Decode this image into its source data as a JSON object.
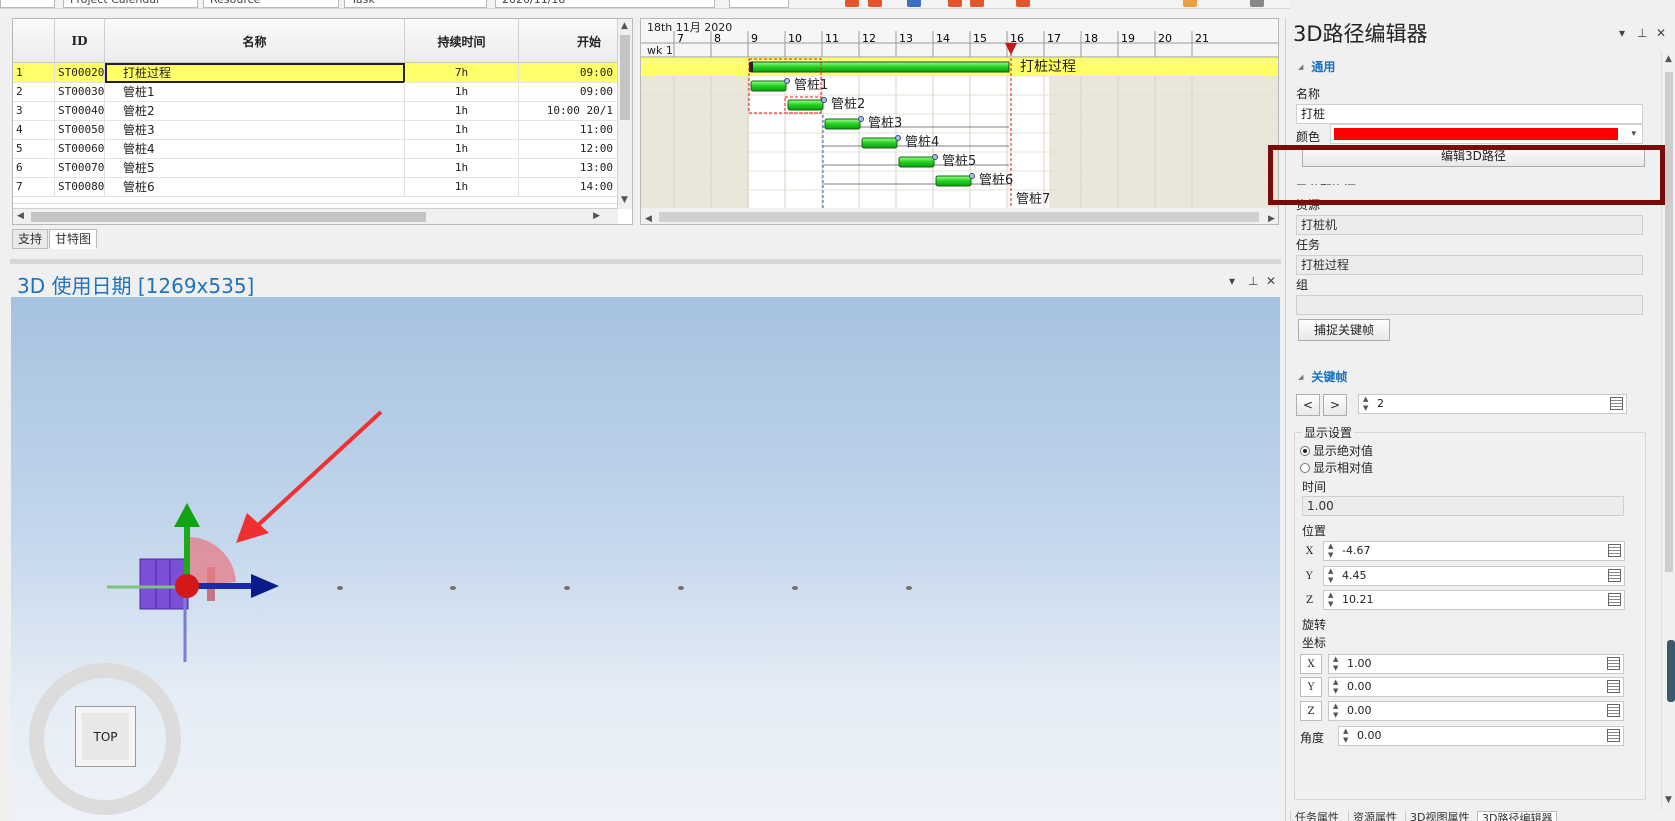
{
  "toolbar": {
    "calendar": "Project Calendar",
    "resource": "Resource",
    "task": "Task",
    "date": "2020/11/18"
  },
  "grid": {
    "headers": {
      "id": "ID",
      "name": "名称",
      "duration": "持续时间",
      "start": "开始"
    },
    "rows": [
      {
        "num": "1",
        "id": "ST00020",
        "name": "打桩过程",
        "duration": "7h",
        "start": "09:00"
      },
      {
        "num": "2",
        "id": "ST00030",
        "name": "管桩1",
        "duration": "1h",
        "start": "09:00"
      },
      {
        "num": "3",
        "id": "ST00040",
        "name": "管桩2",
        "duration": "1h",
        "start": "10:00 20/1"
      },
      {
        "num": "4",
        "id": "ST00050",
        "name": "管桩3",
        "duration": "1h",
        "start": "11:00"
      },
      {
        "num": "5",
        "id": "ST00060",
        "name": "管桩4",
        "duration": "1h",
        "start": "12:00"
      },
      {
        "num": "6",
        "id": "ST00070",
        "name": "管桩5",
        "duration": "1h",
        "start": "13:00"
      },
      {
        "num": "7",
        "id": "ST00080",
        "name": "管桩6",
        "duration": "1h",
        "start": "14:00"
      }
    ]
  },
  "gantt": {
    "date_label": "18th 11月 2020",
    "week_label": "wk 1",
    "hours": [
      "7",
      "8",
      "9",
      "10",
      "11",
      "12",
      "13",
      "14",
      "15",
      "16",
      "17",
      "18",
      "19",
      "20",
      "21"
    ],
    "summary_label": "打桩过程",
    "bar_labels": [
      "管桩1",
      "管桩2",
      "管桩3",
      "管桩4",
      "管桩5",
      "管桩6",
      "管桩7"
    ]
  },
  "left_tabs": [
    "支持",
    "甘特图"
  ],
  "viewport": {
    "title": "3D 使用日期  [1269x535]",
    "nav_label": "TOP"
  },
  "panel": {
    "title": "3D路径编辑器",
    "section_general": "通用",
    "name_label": "名称",
    "name_value": "打桩",
    "color_label": "颜色",
    "color_value": "#ff0000",
    "edit_path_button": "编辑3D路径",
    "assigned_resources": "已分配资源",
    "resource_label": "资源",
    "resource_value": "打桩机",
    "task_label": "任务",
    "task_value": "打桩过程",
    "group_label": "组",
    "group_value": "",
    "capture_button": "捕捉关键帧",
    "section_keyframes": "关键帧",
    "prev": "<",
    "next": ">",
    "keyframe_index": "2",
    "display_settings": "显示设置",
    "radio_absolute": "显示绝对值",
    "radio_relative": "显示相对值",
    "time_label": "时间",
    "time_value": "1.00",
    "position_label": "位置",
    "pos_x": "-4.67",
    "pos_y": "4.45",
    "pos_z": "10.21",
    "rotation_label": "旋转",
    "coord_label": "坐标",
    "rot_x": "1.00",
    "rot_y": "0.00",
    "rot_z": "0.00",
    "angle_label": "角度",
    "angle_value": "0.00",
    "bottom_tabs": [
      "任务属性",
      "资源属性",
      "3D视图属性",
      "3D路径编辑器"
    ]
  }
}
